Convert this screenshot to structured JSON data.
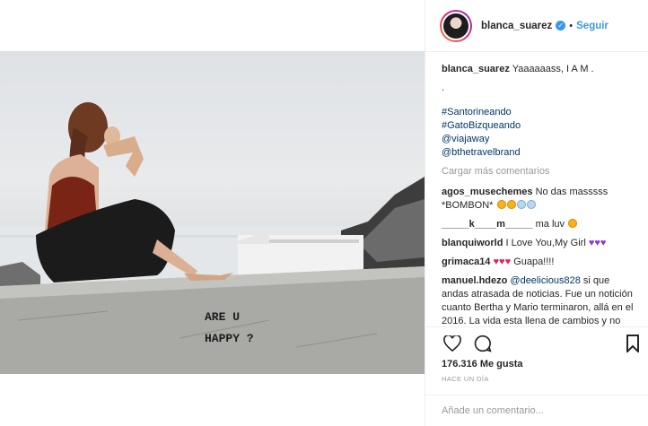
{
  "header": {
    "username": "blanca_suarez",
    "dot": "•",
    "follow_label": "Seguir"
  },
  "photo": {
    "wall_text_line1": "ARE U",
    "wall_text_line2": "HAPPY ?"
  },
  "caption": {
    "username": "blanca_suarez",
    "text": "Yaaaaaass, I A M .",
    "dot_line": ".",
    "tags": [
      "#Santorineando",
      "#GatoBizqueando",
      "@viajaway",
      "@bthetravelbrand"
    ]
  },
  "load_more_label": "Cargar más comentarios",
  "comments": [
    {
      "user": "agos_musechemes",
      "text": "No das masssss *BOMBON*"
    },
    {
      "user": "_____k____m_____",
      "text": "ma luv"
    },
    {
      "user": "blanquiworld",
      "text": "I Love You,My Girl"
    },
    {
      "user": "grimaca14",
      "text": "Guapa!!!!"
    },
    {
      "user": "manuel.hdezo",
      "mention": "@deelicious828",
      "text": "si que andas atrasada de noticias. Fue un notición cuanto Bertha y Mario terminaron, allá en el 2016. La vida esta llena de cambios y no podemos"
    }
  ],
  "likes_text": "176.316 Me gusta",
  "time_text": "HACE UN DÍA",
  "comment_input": {
    "placeholder": "Añade un comentario..."
  },
  "colors": {
    "link": "#3897f0",
    "tag": "#003569",
    "muted": "#999999",
    "heart": "#e0245e",
    "purple_heart": "#8b3fc8"
  },
  "icons": [
    "like-heart-icon",
    "comment-bubble-icon",
    "bookmark-icon",
    "verified-badge-icon"
  ]
}
